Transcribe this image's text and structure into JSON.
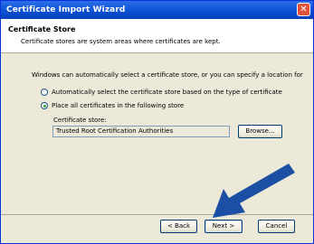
{
  "window": {
    "title": "Certificate Import Wizard"
  },
  "header": {
    "title": "Certificate Store",
    "subtitle": "Certificate stores are system areas where certificates are kept."
  },
  "body": {
    "intro": "Windows can automatically select a certificate store, or you can specify a location for",
    "radio_auto": "Automatically select the certificate store based on the type of certificate",
    "radio_place": "Place all certificates in the following store",
    "store_label": "Certificate store:",
    "store_value": "Trusted Root Certification Authorities",
    "browse": "Browse..."
  },
  "footer": {
    "back": "< Back",
    "next": "Next >",
    "cancel": "Cancel"
  },
  "colors": {
    "titlebar": "#0a4fd1",
    "arrow": "#1a4fa3"
  }
}
